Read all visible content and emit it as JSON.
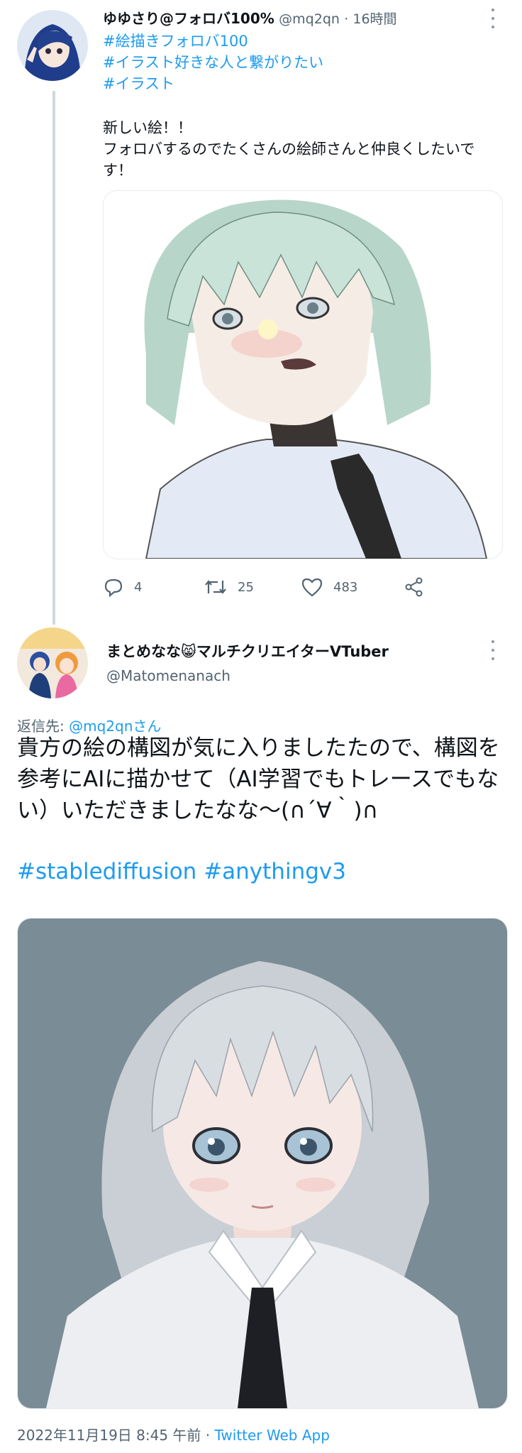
{
  "tweet1": {
    "display_name": "ゆゆさり@フォロバ100%",
    "handle": "@mq2qn",
    "time": "· 16時間",
    "hashtags": [
      "#絵描きフォロバ100",
      "#イラスト好きな人と繋がりたい",
      "#イラスト"
    ],
    "text_line1": "新しい絵！！",
    "text_line2": "フォロバするのでたくさんの絵師さんと仲良くしたいです！",
    "stats": {
      "replies": "4",
      "retweets": "25",
      "likes": "483"
    }
  },
  "tweet2": {
    "display_name": "まとめなな😸マルチクリエイターVTuber",
    "handle": "@Matomenanach",
    "reply_prefix": "返信先: ",
    "reply_mention": "@mq2qnさん",
    "text": "貴方の絵の構図が気に入りましたたので、構図を参考にAIに描かせて（AI学習でもトレースでもない）いただきましたなな〜(∩´∀｀)∩",
    "hashtags": [
      "#stablediffusion",
      "#anythingv3"
    ],
    "date": "2022年11月19日 8:45 午前 · ",
    "source": "Twitter Web App"
  },
  "icons": {
    "more": "more-dots-icon",
    "reply": "reply-icon",
    "retweet": "retweet-icon",
    "like": "heart-icon",
    "share": "share-icon"
  },
  "colors": {
    "link": "#1d9bf0",
    "muted": "#536471",
    "thread_line": "#cfd9de"
  }
}
